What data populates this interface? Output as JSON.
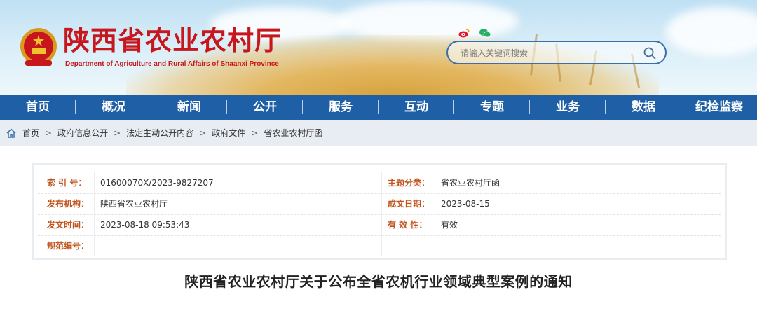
{
  "header": {
    "site_title": "陕西省农业农村厅",
    "site_subtitle": "Department of Agriculture and Rural Affairs of Shaanxi Province",
    "logo_icon": "national-emblem-icon",
    "share_icons": [
      "weibo-icon",
      "wechat-icon"
    ],
    "search": {
      "placeholder": "请输入关键词搜索",
      "icon": "search-icon"
    }
  },
  "nav": {
    "items": [
      "首页",
      "概况",
      "新闻",
      "公开",
      "服务",
      "互动",
      "专题",
      "业务",
      "数据",
      "纪检监察"
    ]
  },
  "breadcrumb": {
    "icon": "home-icon",
    "items": [
      "首页",
      "政府信息公开",
      "法定主动公开内容",
      "政府文件",
      "省农业农村厅函"
    ],
    "separator": ">"
  },
  "info": {
    "index_label": "索 引 号：",
    "index_value": "01600070X/2023-9827207",
    "topic_label": "主题分类：",
    "topic_value": "省农业农村厅函",
    "publisher_label": "发布机构：",
    "publisher_value": "陕西省农业农村厅",
    "date_label": "成文日期：",
    "date_value": "2023-08-15",
    "publish_time_label": "发文时间：",
    "publish_time_value": "2023-08-18 09:53:43",
    "validity_label": "有 效 性：",
    "validity_value": "有效",
    "code_label": "规范编号：",
    "code_value": ""
  },
  "document": {
    "title": "陕西省农业农村厅关于公布全省农机行业领域典型案例的通知"
  },
  "colors": {
    "brand_red": "#c8161d",
    "nav_blue": "#1f5fa6",
    "label_orange": "#c0561f"
  }
}
